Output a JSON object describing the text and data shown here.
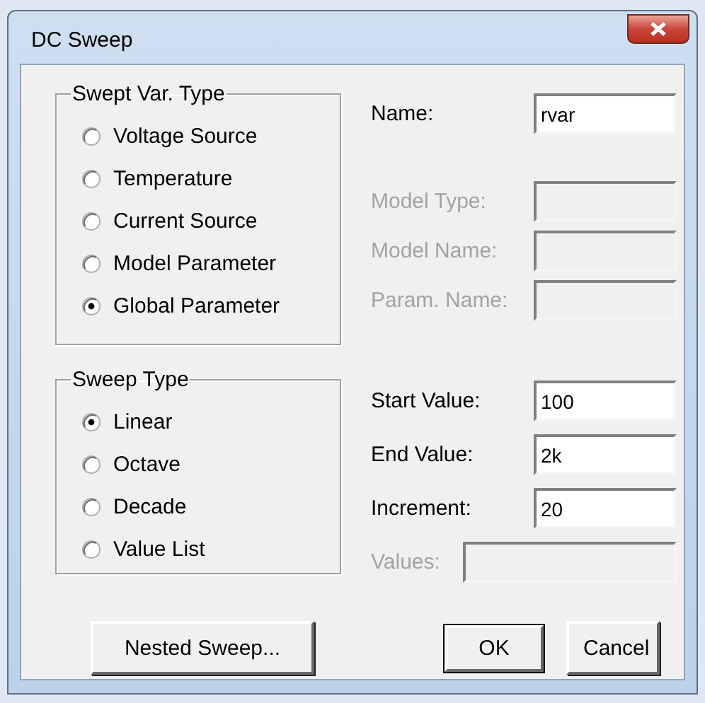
{
  "window": {
    "title": "DC Sweep"
  },
  "swept_var_type": {
    "label": "Swept Var. Type",
    "options": [
      {
        "label": "Voltage Source",
        "selected": false
      },
      {
        "label": "Temperature",
        "selected": false
      },
      {
        "label": "Current Source",
        "selected": false
      },
      {
        "label": "Model Parameter",
        "selected": false
      },
      {
        "label": "Global Parameter",
        "selected": true
      }
    ]
  },
  "variable_fields": [
    {
      "label": "Name:",
      "value": "rvar",
      "disabled": false
    },
    {
      "label": "Model Type:",
      "disabled": true
    },
    {
      "label": "Model Name:",
      "disabled": true
    },
    {
      "label": "Param. Name:",
      "disabled": true
    }
  ],
  "sweep_type": {
    "label": "Sweep Type",
    "options": [
      {
        "label": "Linear",
        "selected": true
      },
      {
        "label": "Octave",
        "selected": false
      },
      {
        "label": "Decade",
        "selected": false
      },
      {
        "label": "Value List",
        "selected": false
      }
    ]
  },
  "value_fields": [
    {
      "label": "Start Value:",
      "value": "100",
      "disabled": false,
      "kind": "short"
    },
    {
      "label": "End Value:",
      "value": "2k",
      "disabled": false,
      "kind": "short"
    },
    {
      "label": "Increment:",
      "value": "20",
      "disabled": false,
      "kind": "short"
    },
    {
      "label": "Values:",
      "disabled": true,
      "kind": "wide"
    }
  ],
  "buttons": [
    {
      "label": "Nested Sweep...",
      "default": false
    },
    {
      "label": "OK",
      "default": true
    },
    {
      "label": "Cancel",
      "default": false
    }
  ]
}
